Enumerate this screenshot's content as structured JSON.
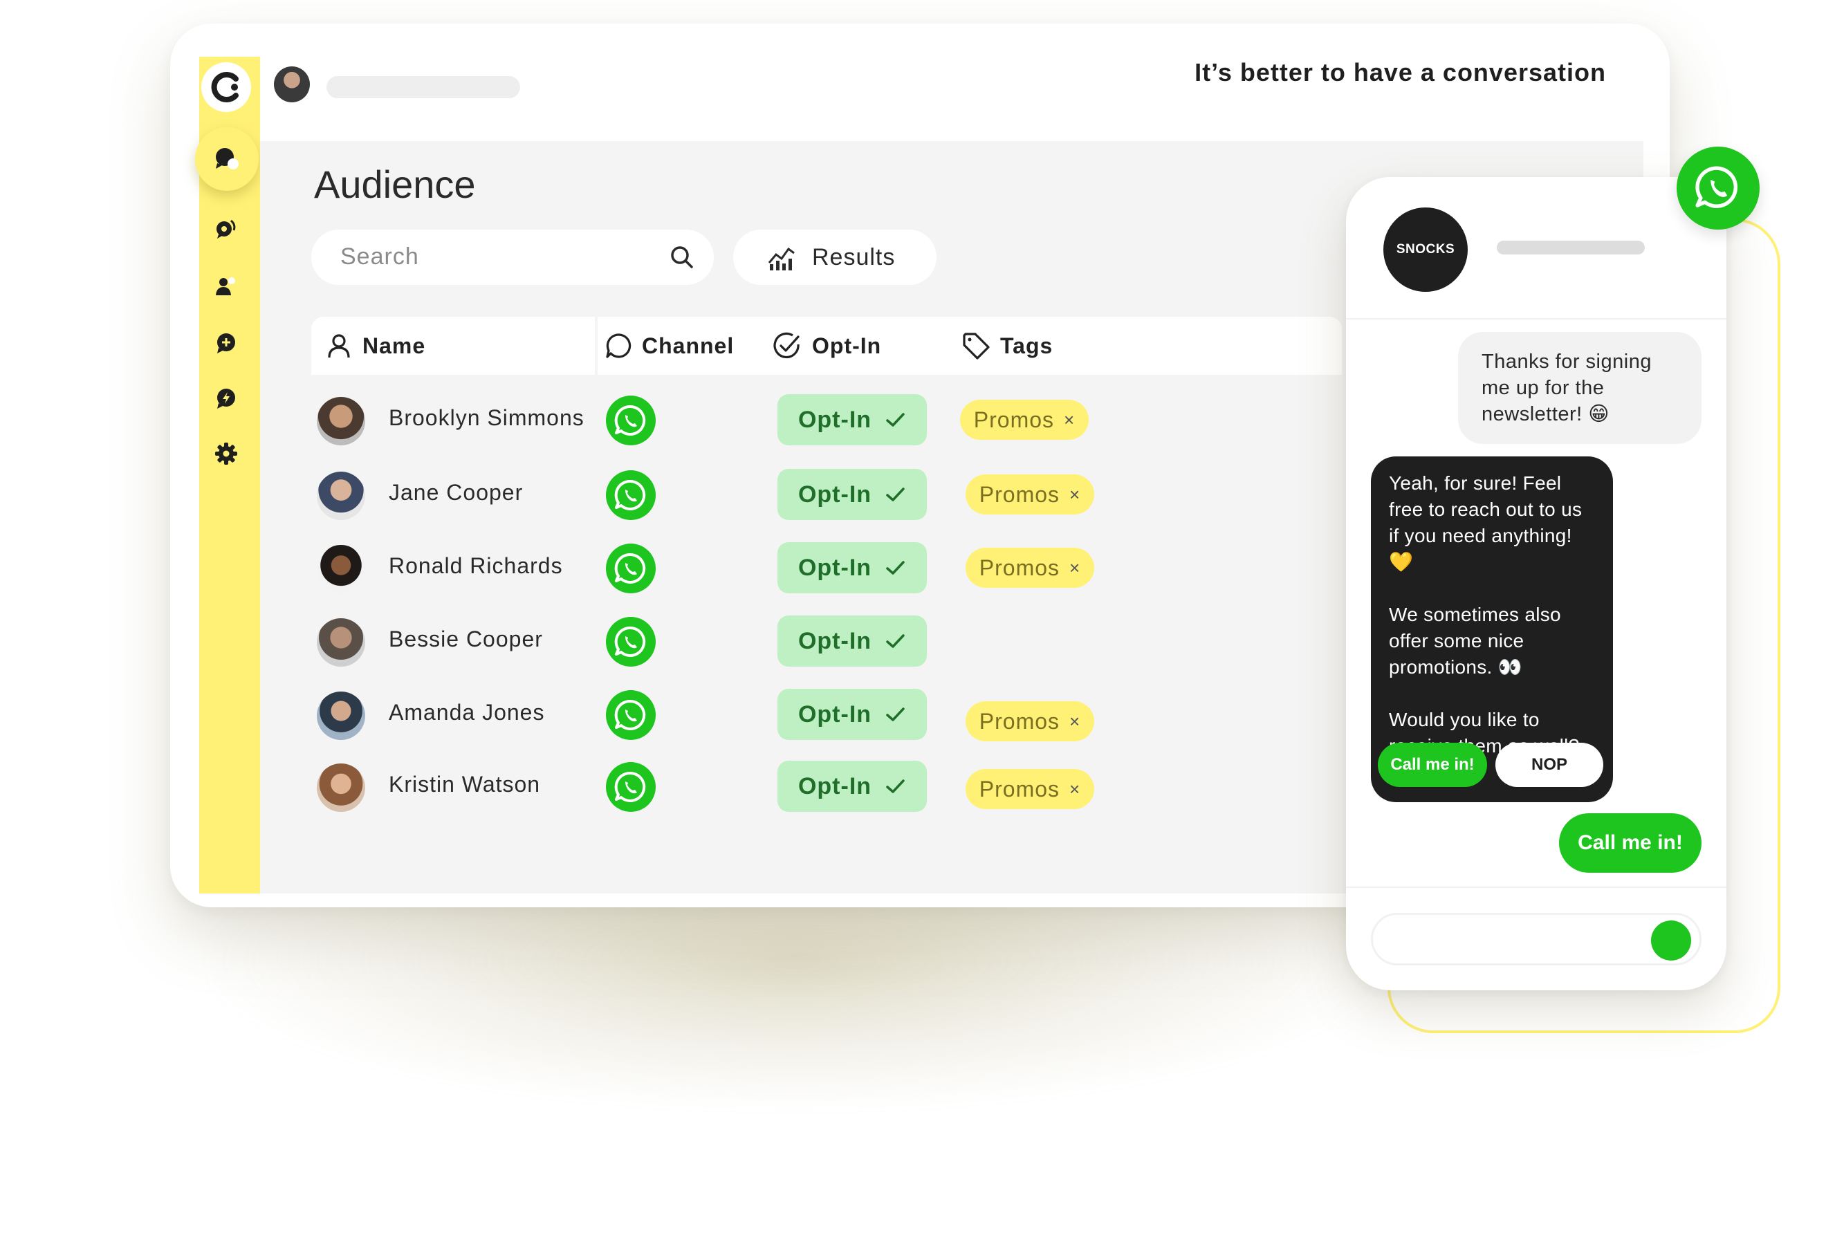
{
  "header": {
    "tagline": "It’s better to have a conversation"
  },
  "sidebar": {
    "items": [
      {
        "icon": "chat-bubble-icon",
        "active": true
      },
      {
        "icon": "broadcast-icon"
      },
      {
        "icon": "audience-icon"
      },
      {
        "icon": "add-message-icon"
      },
      {
        "icon": "automation-icon"
      },
      {
        "icon": "gear-icon"
      }
    ]
  },
  "page": {
    "title": "Audience",
    "search_placeholder": "Search",
    "results_label": "Results"
  },
  "table": {
    "columns": [
      "Name",
      "Channel",
      "Opt-In",
      "Tags"
    ],
    "rows": [
      {
        "name": "Brooklyn Simmons",
        "optin": "Opt-In",
        "tag": "Promos"
      },
      {
        "name": "Jane Cooper",
        "optin": "Opt-In",
        "tag": "Promos"
      },
      {
        "name": "Ronald Richards",
        "optin": "Opt-In",
        "tag": "Promos"
      },
      {
        "name": "Bessie Cooper",
        "optin": "Opt-In",
        "tag": ""
      },
      {
        "name": "Amanda Jones",
        "optin": "Opt-In",
        "tag": "Promos"
      },
      {
        "name": "Kristin Watson",
        "optin": "Opt-In",
        "tag": "Promos"
      }
    ],
    "tag_remove": "×"
  },
  "chat": {
    "brand": "SNOCKS",
    "user_message": "Thanks for signing me up for the newsletter! 😁",
    "bot_message_1": "Yeah, for sure! Feel free to reach out to us if you need anything! 💛",
    "bot_message_2": "We sometimes also offer some nice promotions. 👀",
    "bot_message_3": "Would you like to receive them as well?",
    "option_yes": "Call me in!",
    "option_no": "NOP",
    "user_reply": "Call me in!"
  },
  "colors": {
    "brand_yellow": "#fff176",
    "whatsapp_green": "#1ec51e",
    "optin_bg": "#bff0c4",
    "optin_text": "#1f6e2a",
    "dark": "#1f1f1f"
  }
}
